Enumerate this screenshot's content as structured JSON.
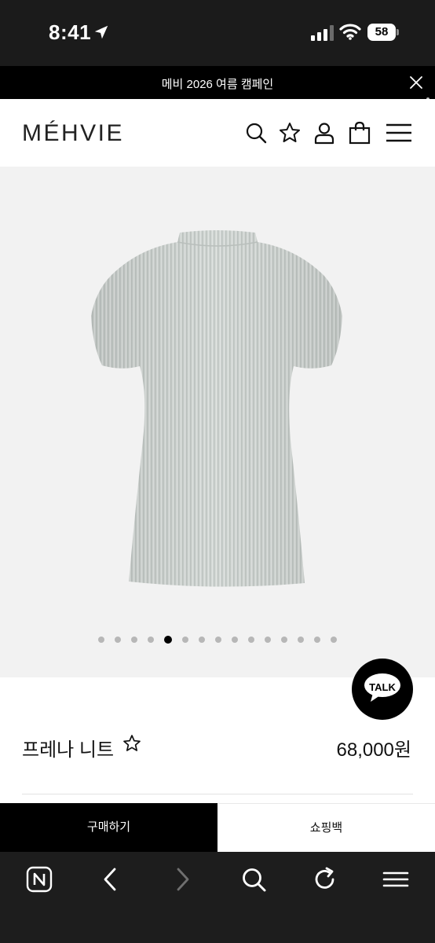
{
  "status_bar": {
    "time": "8:41",
    "battery": "58"
  },
  "promo": {
    "text": "메비 2026 여름 캠페인"
  },
  "header": {
    "logo": "MÉHVIE",
    "icons": [
      "search-icon",
      "star-icon",
      "user-icon",
      "shopping-bag-icon",
      "menu-icon"
    ]
  },
  "gallery": {
    "image": "pleated-knit-top",
    "total_images": 15,
    "active_index": 5
  },
  "chat": {
    "label": "TALK"
  },
  "product": {
    "name": "프레나 니트",
    "price": "68,000원"
  },
  "actions": {
    "buy_label": "구매하기",
    "bag_label": "쇼핑백"
  },
  "browser": {
    "icons": [
      "naver-icon",
      "back-icon",
      "forward-icon",
      "search-icon",
      "reload-icon",
      "menu-icon"
    ]
  },
  "colors": {
    "dark": "#000000",
    "gallery_bg": "#f2f2f2",
    "garment": "#d3d8d5"
  }
}
